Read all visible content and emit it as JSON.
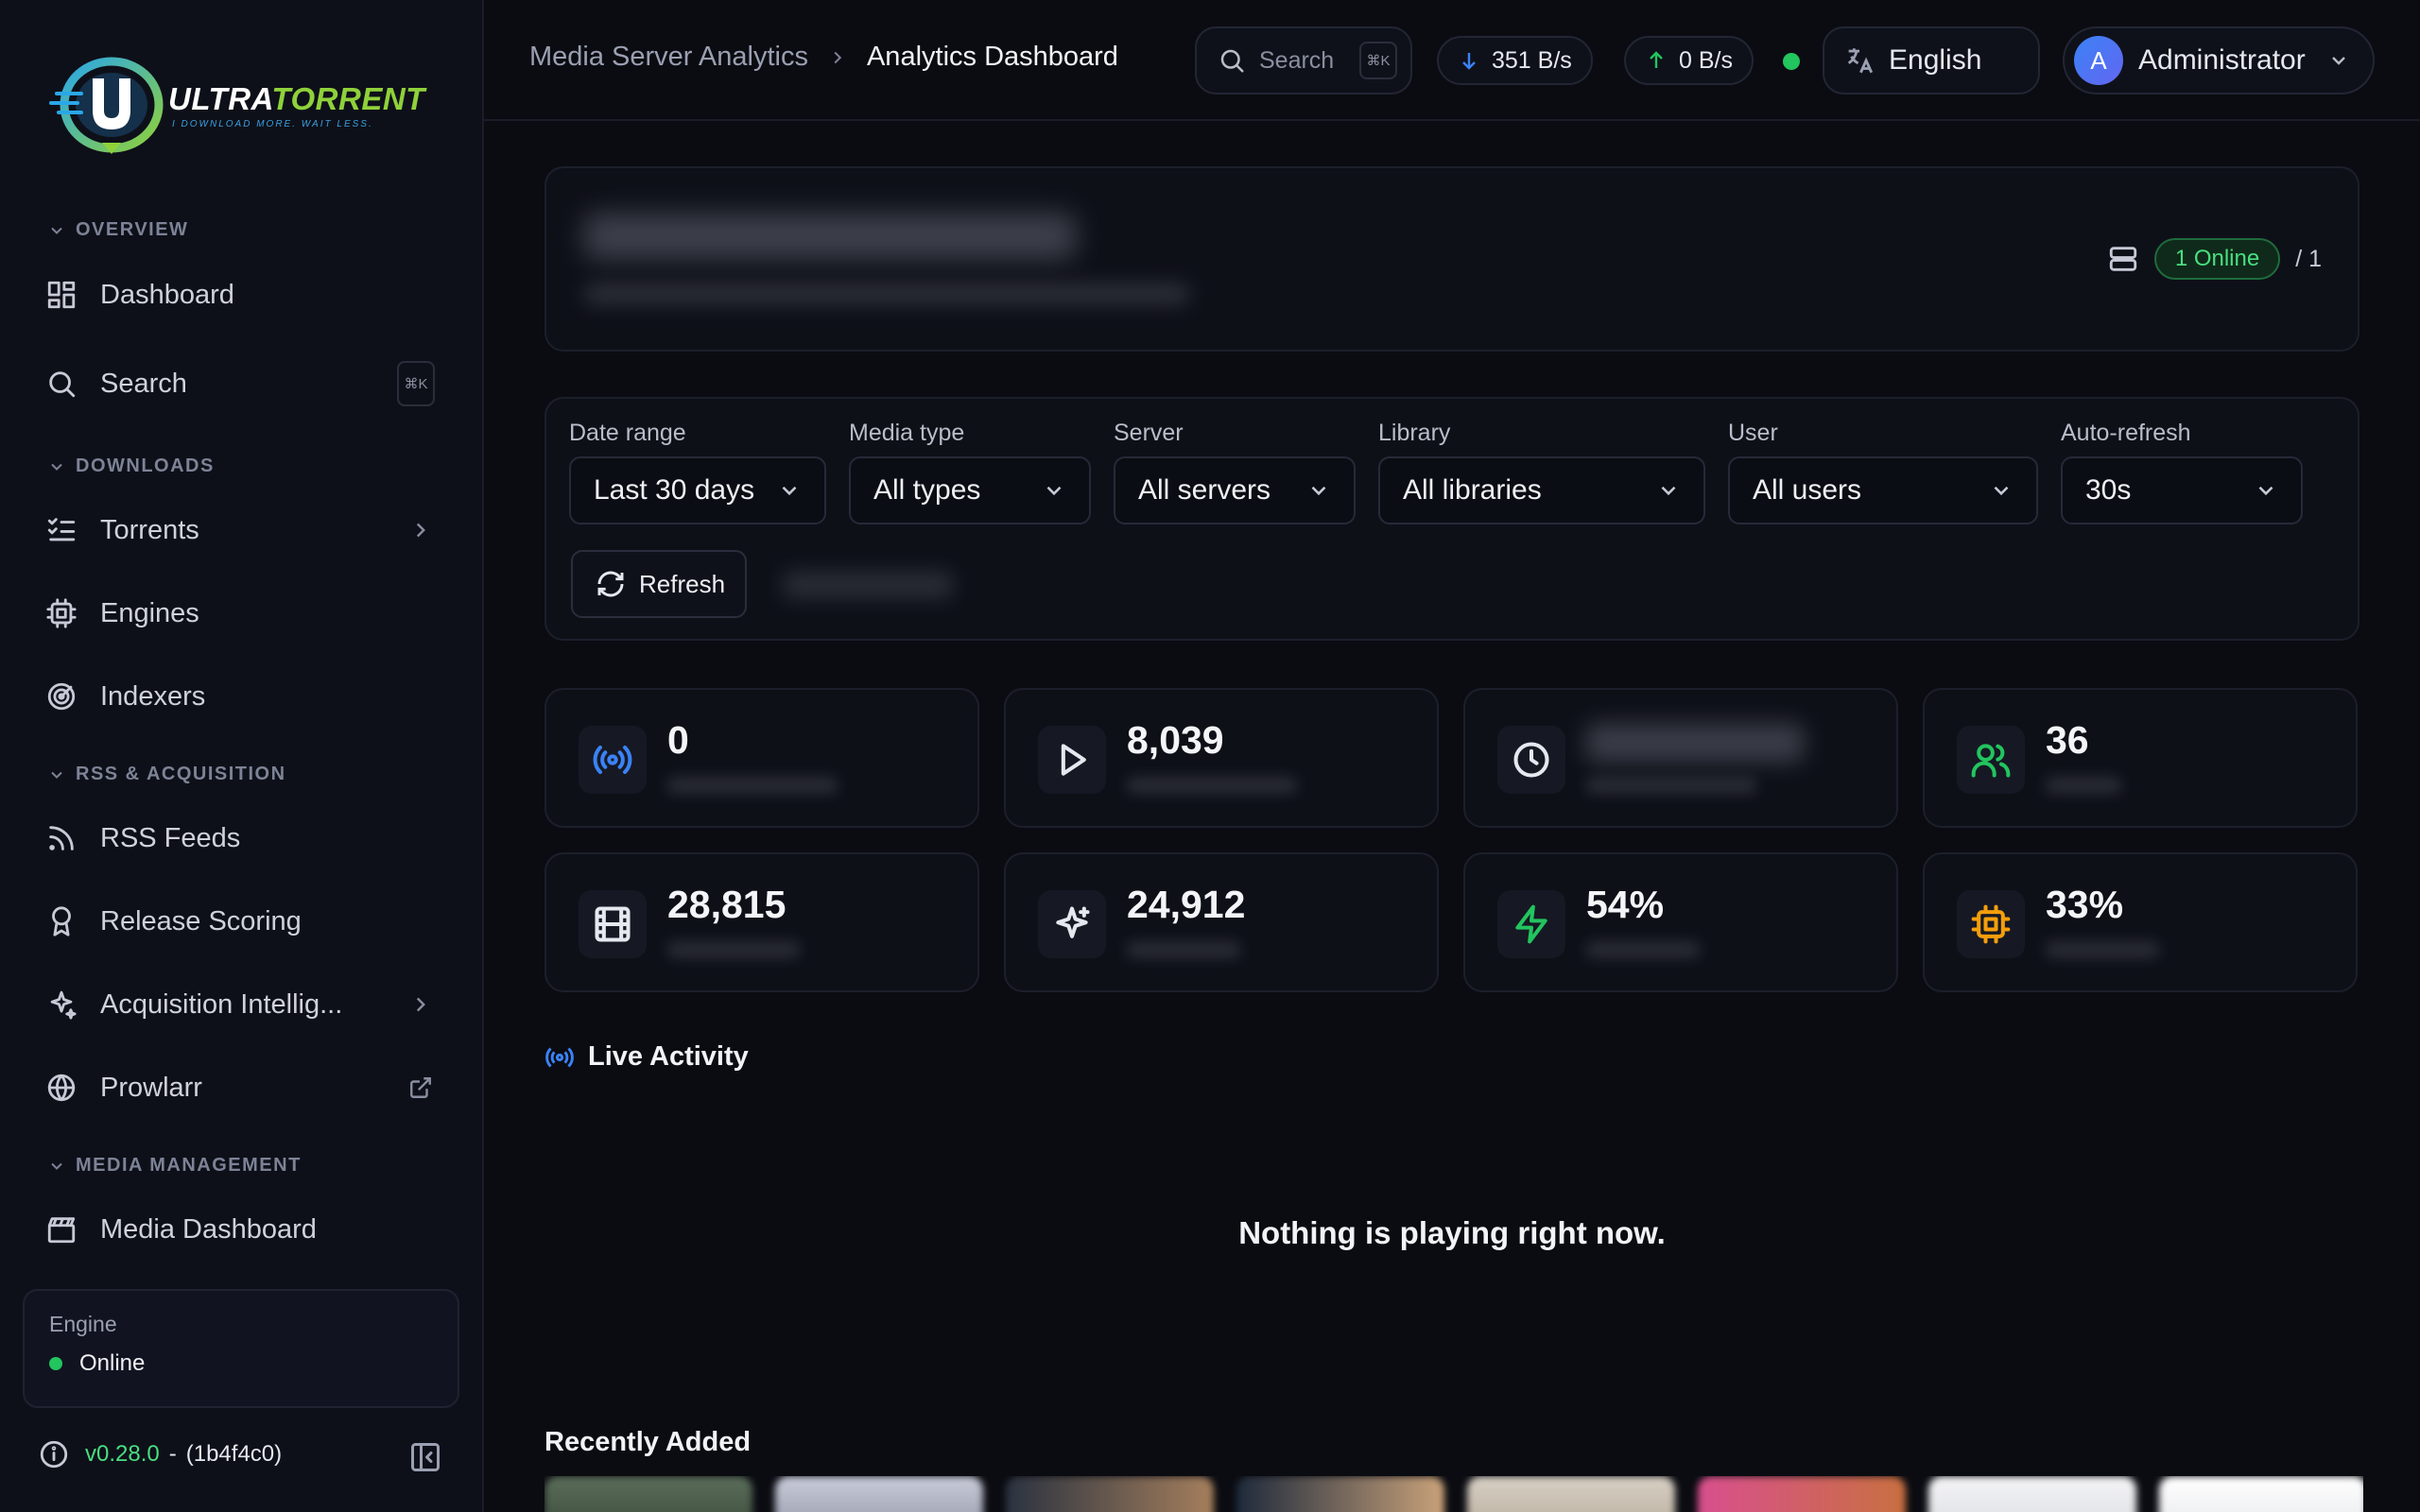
{
  "brand": {
    "name_part1": "ULTRA",
    "name_part2": "TORRENT",
    "tagline": "I DOWNLOAD MORE.  WAIT LESS.",
    "colors": {
      "accent_green": "#8fd13a",
      "accent_blue": "#3aa0e0"
    }
  },
  "sidebar": {
    "sections": [
      {
        "title": "OVERVIEW"
      },
      {
        "title": "DOWNLOADS"
      },
      {
        "title": "RSS & ACQUISITION"
      },
      {
        "title": "MEDIA MANAGEMENT"
      }
    ],
    "items": [
      {
        "label": "Dashboard",
        "icon": "dashboard-grid-icon"
      },
      {
        "label": "Search",
        "icon": "search-icon",
        "shortcut": "⌘K"
      },
      {
        "label": "Torrents",
        "icon": "list-checks-icon"
      },
      {
        "label": "Engines",
        "icon": "cpu-icon"
      },
      {
        "label": "Indexers",
        "icon": "radar-icon"
      },
      {
        "label": "RSS Feeds",
        "icon": "rss-icon"
      },
      {
        "label": "Release Scoring",
        "icon": "award-icon"
      },
      {
        "label": "Acquisition Intellig...",
        "icon": "sparkles-icon"
      },
      {
        "label": "Prowlarr",
        "icon": "globe-icon"
      },
      {
        "label": "Media Dashboard",
        "icon": "clapperboard-icon"
      }
    ],
    "engine": {
      "label": "Engine",
      "status": "Online",
      "status_color": "#22c55e"
    },
    "version": {
      "number": "v0.28.0",
      "separator": "-",
      "commit": "(1b4f4c0)"
    }
  },
  "header": {
    "breadcrumb": {
      "parent": "Media Server Analytics",
      "current": "Analytics Dashboard"
    },
    "search": {
      "placeholder": "Search",
      "shortcut": "⌘K"
    },
    "download_speed": "351 B/s",
    "upload_speed": "0 B/s",
    "connection_status_color": "#22c55e",
    "language": "English",
    "user": {
      "initial": "A",
      "name": "Administrator"
    }
  },
  "hero": {
    "server_status": "1 Online",
    "server_total": "/ 1"
  },
  "filters": {
    "date_range": {
      "label": "Date range",
      "value": "Last 30 days"
    },
    "media_type": {
      "label": "Media type",
      "value": "All types"
    },
    "server": {
      "label": "Server",
      "value": "All servers"
    },
    "library": {
      "label": "Library",
      "value": "All libraries"
    },
    "user": {
      "label": "User",
      "value": "All users"
    },
    "auto_refresh": {
      "label": "Auto-refresh",
      "value": "30s"
    },
    "refresh_label": "Refresh"
  },
  "stats": [
    {
      "value": "0",
      "icon": "broadcast-icon",
      "color": "#3b82f6"
    },
    {
      "value": "8,039",
      "icon": "play-icon",
      "color": "#e6e8ef"
    },
    {
      "value": "",
      "icon": "clock-icon",
      "color": "#e6e8ef"
    },
    {
      "value": "36",
      "icon": "users-icon",
      "color": "#22c55e"
    },
    {
      "value": "28,815",
      "icon": "film-icon",
      "color": "#e6e8ef"
    },
    {
      "value": "24,912",
      "icon": "sparkle-icon",
      "color": "#e6e8ef"
    },
    {
      "value": "54%",
      "icon": "zap-icon",
      "color": "#22c55e"
    },
    {
      "value": "33%",
      "icon": "cpu-icon",
      "color": "#f59e0b"
    }
  ],
  "live_activity": {
    "title": "Live Activity",
    "empty_message": "Nothing is playing right now."
  },
  "recently_added": {
    "title": "Recently Added"
  }
}
